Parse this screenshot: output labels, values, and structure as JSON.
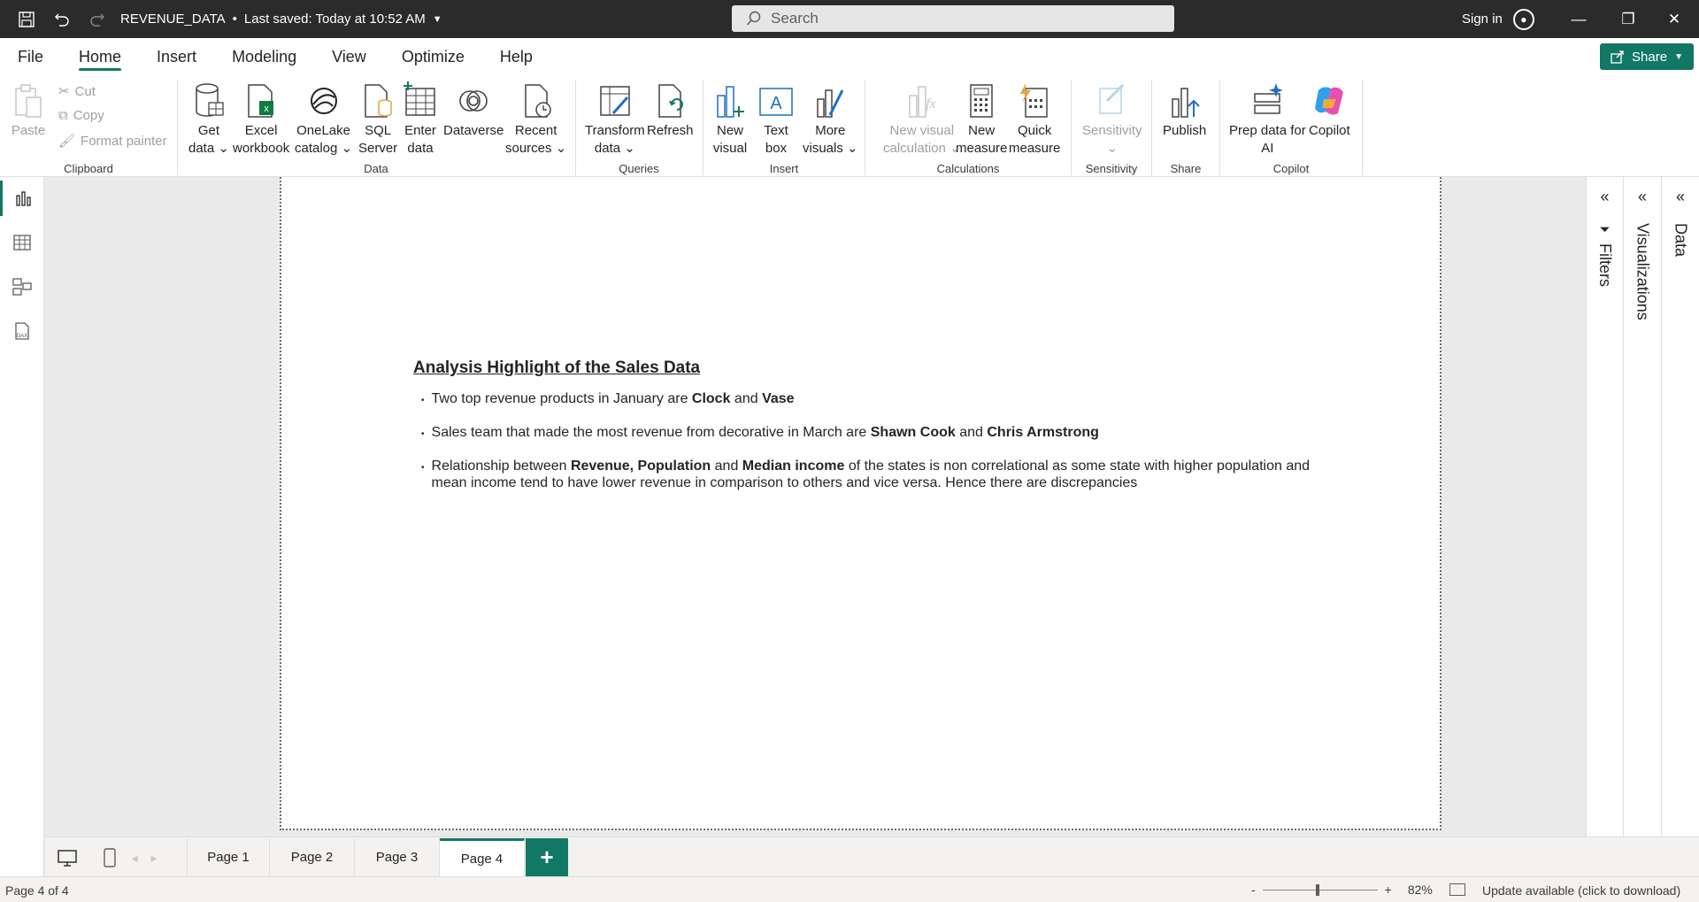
{
  "titlebar": {
    "file_title": "REVENUE_DATA",
    "saved_status": "Last saved: Today at 10:52 AM",
    "search_placeholder": "Search",
    "sign_in": "Sign in"
  },
  "menu": {
    "tabs": [
      "File",
      "Home",
      "Insert",
      "Modeling",
      "View",
      "Optimize",
      "Help"
    ],
    "active": "Home",
    "share_label": "Share"
  },
  "ribbon": {
    "clipboard": {
      "label": "Clipboard",
      "paste": "Paste",
      "cut": "Cut",
      "copy": "Copy",
      "format_painter": "Format painter"
    },
    "data": {
      "label": "Data",
      "get_data": [
        "Get",
        "data"
      ],
      "excel": [
        "Excel",
        "workbook"
      ],
      "onelake": [
        "OneLake",
        "catalog"
      ],
      "sql": [
        "SQL",
        "Server"
      ],
      "enter": [
        "Enter",
        "data"
      ],
      "dataverse": [
        "Dataverse",
        ""
      ],
      "recent": [
        "Recent",
        "sources"
      ]
    },
    "queries": {
      "label": "Queries",
      "transform": [
        "Transform",
        "data"
      ],
      "refresh": [
        "Refresh",
        ""
      ]
    },
    "insert": {
      "label": "Insert",
      "new_visual": [
        "New",
        "visual"
      ],
      "text_box": [
        "Text",
        "box"
      ],
      "more_visuals": [
        "More",
        "visuals"
      ]
    },
    "calculations": {
      "label": "Calculations",
      "new_visual_calc": [
        "New visual",
        "calculation"
      ],
      "new_measure": [
        "New",
        "measure"
      ],
      "quick_measure": [
        "Quick",
        "measure"
      ]
    },
    "sensitivity": {
      "label": "Sensitivity",
      "sensitivity": [
        "Sensitivity",
        ""
      ]
    },
    "share": {
      "label": "Share",
      "publish": [
        "Publish",
        ""
      ]
    },
    "copilot": {
      "label": "Copilot",
      "prep": [
        "Prep data for",
        "AI"
      ],
      "copilot": [
        "Copilot",
        ""
      ]
    }
  },
  "report": {
    "heading": "Analysis Highlight of the Sales Data ",
    "bullet1": {
      "t1": "Two top revenue products in January are ",
      "b1": "Clock",
      "t2": " and ",
      "b2": "Vase"
    },
    "bullet2": {
      "t1": "Sales team that made the most revenue from decorative in March are ",
      "b1": "Shawn Cook",
      "t2": " and ",
      "b2": "Chris Armstrong"
    },
    "bullet3": {
      "t1": "Relationship between ",
      "b1": "Revenue, Population",
      "t2": " and ",
      "b2": "Median income",
      "t3": " of the states is non correlational as some state with higher population and mean income tend to have lower revenue in comparison to others and vice versa. Hence there are discrepancies"
    }
  },
  "panes": {
    "filters": "Filters",
    "visualizations": "Visualizations",
    "data": "Data"
  },
  "pages": {
    "tabs": [
      "Page 1",
      "Page 2",
      "Page 3",
      "Page 4"
    ],
    "active": "Page 4",
    "add": "+"
  },
  "status": {
    "page_indicator": "Page 4 of 4",
    "zoom_minus": "-",
    "zoom_plus": "+",
    "zoom_level": "82%",
    "update": "Update available (click to download)"
  },
  "colors": {
    "accent": "#117865",
    "titlebar": "#2b2b2b"
  },
  "icons": [
    "save-icon",
    "undo-icon",
    "redo-icon",
    "search-icon",
    "account-icon",
    "minimize-icon",
    "restore-icon",
    "close-icon",
    "share-icon",
    "report-view-icon",
    "table-view-icon",
    "model-view-icon",
    "dax-query-icon",
    "filter-icon",
    "desktop-layout-icon",
    "mobile-layout-icon"
  ]
}
